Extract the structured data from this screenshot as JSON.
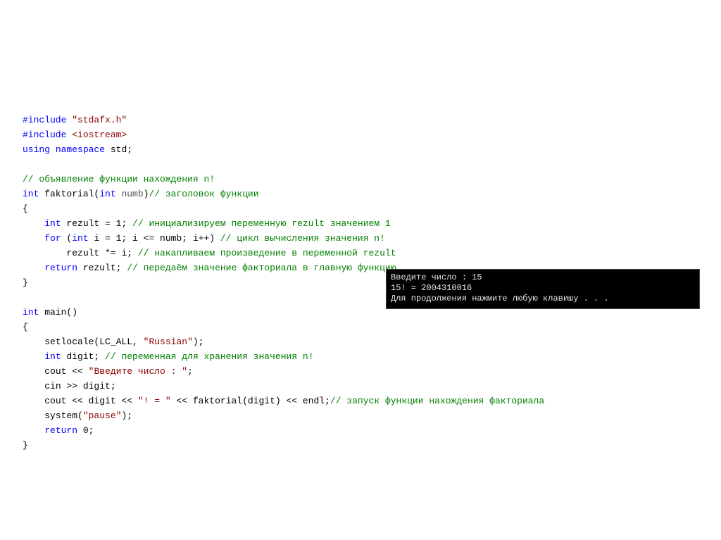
{
  "code": {
    "include1_pre": "#include ",
    "include1_file": "\"stdafx.h\"",
    "include2_pre": "#include ",
    "include2_file": "<iostream>",
    "using": "using",
    "namespace": "namespace",
    "std": " std;",
    "comment_decl": "// объявление функции нахождения n!",
    "int": "int",
    "faktorial": " faktorial(",
    "numb": " numb",
    "close_paren": ")",
    "comment_header": "// заголовок функции",
    "brace_open": "{",
    "indent": "    ",
    "rezult_decl": " rezult = 1; ",
    "comment_init": "// инициализируем переменную rezult значением 1",
    "for": "for",
    "for_args": " (",
    "for_i_decl": " i = 1; i <= numb; i++) ",
    "comment_loop": "// цикл вычисления значения n!",
    "indent2": "        ",
    "rezult_mul": "rezult *= i; ",
    "comment_accum": "// накапливаем произведение в переменной rezult",
    "return": "return",
    "return_val": " rezult; ",
    "comment_return": "// передаём значение факториала в главную функцию",
    "brace_close": "}",
    "main": " main()",
    "setlocale": "setlocale(LC_ALL, ",
    "russian": "\"Russian\"",
    "close_stmt": ");",
    "digit_decl": " digit; ",
    "comment_digit": "// переменная для хранения значения n!",
    "cout": "cout << ",
    "prompt": "\"Введите число : \"",
    "semi": ";",
    "cin": "cin >> digit;",
    "cout2a": "cout << digit << ",
    "excl": "\"! = \"",
    "cout2b": " << faktorial(digit) << endl;",
    "comment_call": "// запуск функции нахождения факториала",
    "system": "system(",
    "pause": "\"pause\"",
    "return0": " 0;"
  },
  "console": {
    "line1": "Введите число : 15",
    "line2": "15! = 2004310016",
    "line3": "Для продолжения нажмите любую клавишу . . ."
  }
}
